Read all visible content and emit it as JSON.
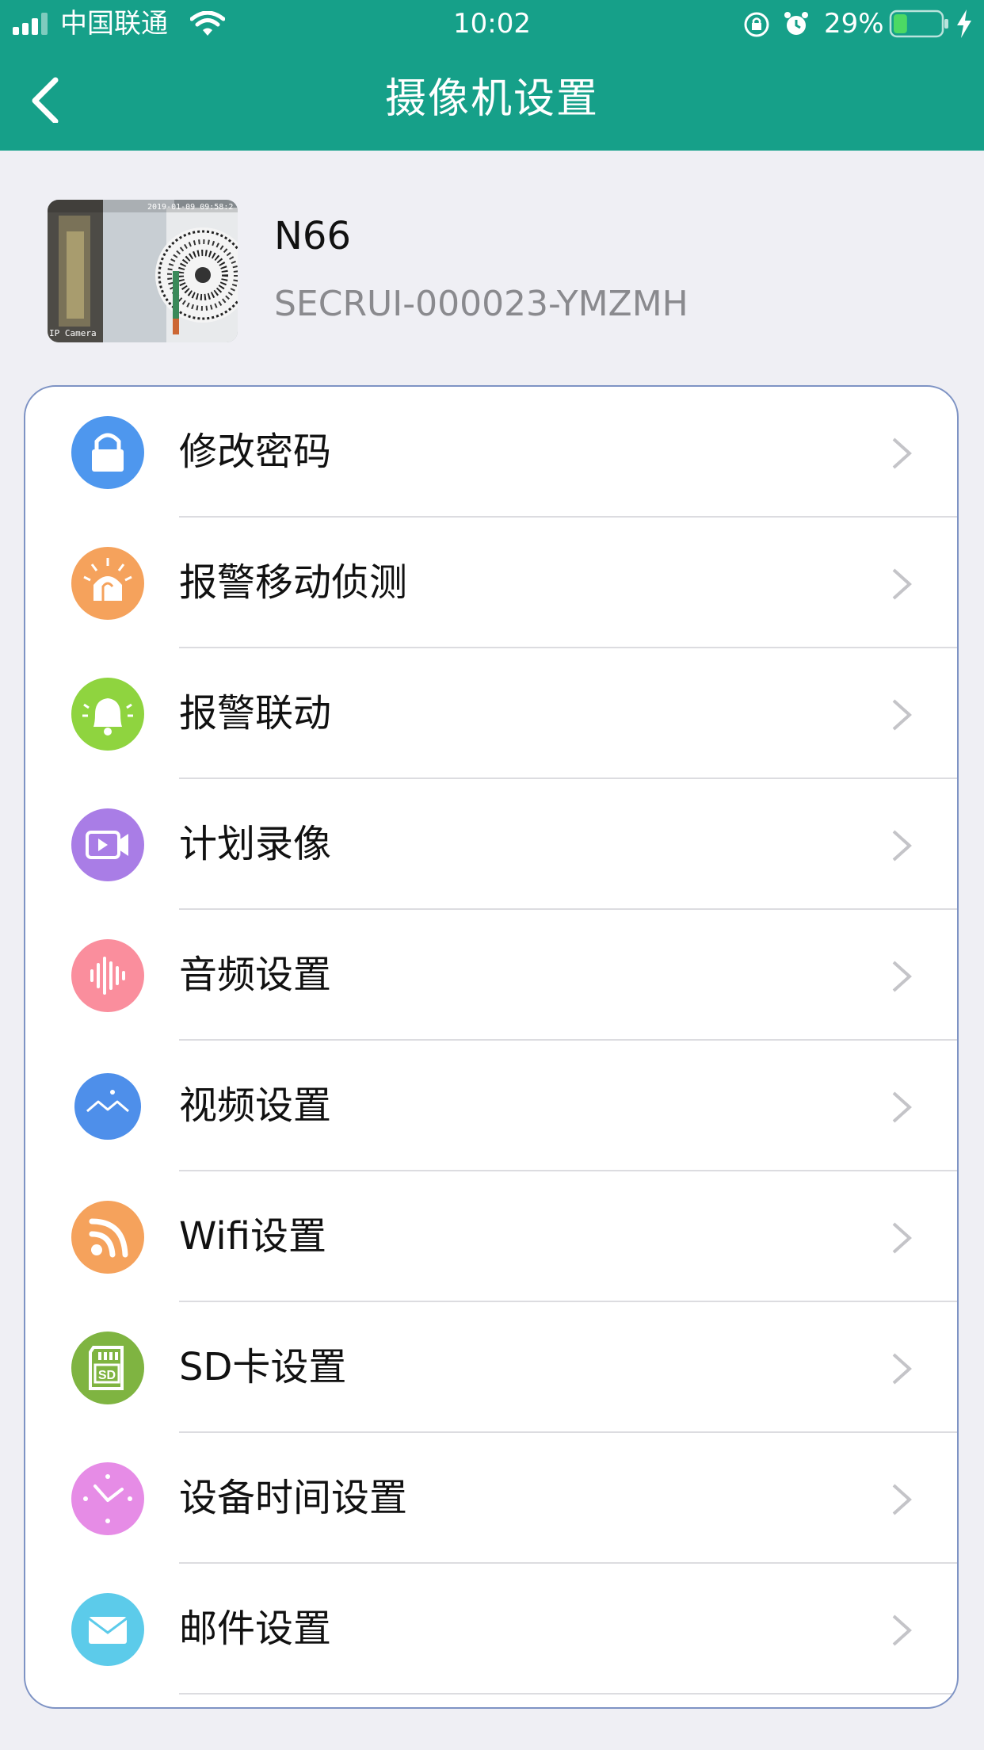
{
  "status_bar": {
    "carrier": "中国联通",
    "time": "10:02",
    "battery": "29%",
    "battery_level": 0.29
  },
  "header": {
    "title": "摄像机设置"
  },
  "camera": {
    "name": "N66",
    "id": "SECRUI-000023-YMZMH",
    "thumb_timestamp": "2019-01-09 09:58:2",
    "thumb_label": "IP Camera"
  },
  "menu": [
    {
      "label": "修改密码",
      "icon": "lock-icon",
      "color": "#4e97ee"
    },
    {
      "label": "报警移动侦测",
      "icon": "alarm-light-icon",
      "color": "#f5a25c"
    },
    {
      "label": "报警联动",
      "icon": "bell-icon",
      "color": "#8fd43f"
    },
    {
      "label": "计划录像",
      "icon": "video-camera-icon",
      "color": "#a97de6"
    },
    {
      "label": "音频设置",
      "icon": "audio-wave-icon",
      "color": "#fa8e9d"
    },
    {
      "label": "视频设置",
      "icon": "landscape-icon",
      "color": "#4e8fea"
    },
    {
      "label": "Wifi设置",
      "icon": "wifi-icon",
      "color": "#f5a25c"
    },
    {
      "label": "SD卡设置",
      "icon": "sd-card-icon",
      "color": "#7fb441"
    },
    {
      "label": "设备时间设置",
      "icon": "clock-icon",
      "color": "#e68ce6"
    },
    {
      "label": "邮件设置",
      "icon": "mail-icon",
      "color": "#5ccbea"
    }
  ],
  "colors": {
    "header_bg": "#16a089",
    "page_bg": "#efeff4"
  }
}
